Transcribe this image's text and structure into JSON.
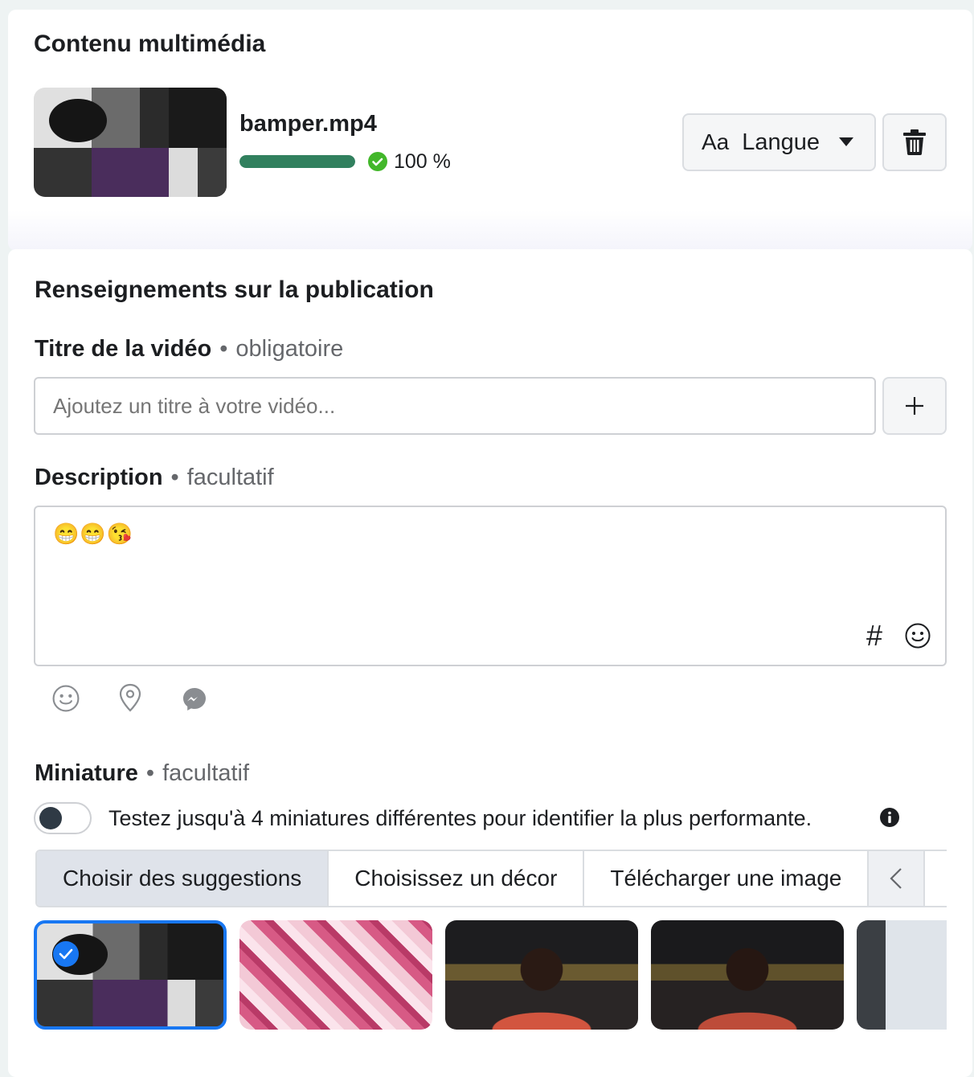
{
  "media": {
    "heading": "Contenu multimédia",
    "file_name": "bamper.mp4",
    "progress": 1.0,
    "progress_label": "100 %",
    "language_icon_text": "Aa",
    "language_label": "Langue"
  },
  "publication": {
    "heading": "Renseignements sur la publication",
    "title_label": "Titre de la vidéo",
    "title_sep": "•",
    "title_required": "obligatoire",
    "title_placeholder": "Ajoutez un titre à votre vidéo...",
    "title_value": "",
    "description_label": "Description",
    "description_sep": "•",
    "description_optional": "facultatif",
    "description_value": "😁😁😘",
    "hashtag_symbol": "#"
  },
  "thumbnail": {
    "label": "Miniature",
    "sep": "•",
    "optional": "facultatif",
    "toggle_on": false,
    "toggle_text": "Testez jusqu'à 4 miniatures différentes pour identifier la plus performante.",
    "tabs": [
      {
        "label": "Choisir des suggestions",
        "active": true
      },
      {
        "label": "Choisissez un décor",
        "active": false
      },
      {
        "label": "Télécharger une image",
        "active": false
      }
    ],
    "selected_index": 0
  },
  "colors": {
    "accent": "#1877f2",
    "progress": "#31805e",
    "check": "#42b72a"
  },
  "icons": [
    "trash-icon",
    "caret-down-icon",
    "plus-icon",
    "hashtag-icon",
    "smiley-icon",
    "location-pin-icon",
    "messenger-icon",
    "info-icon",
    "chevron-left-icon",
    "check-icon"
  ]
}
